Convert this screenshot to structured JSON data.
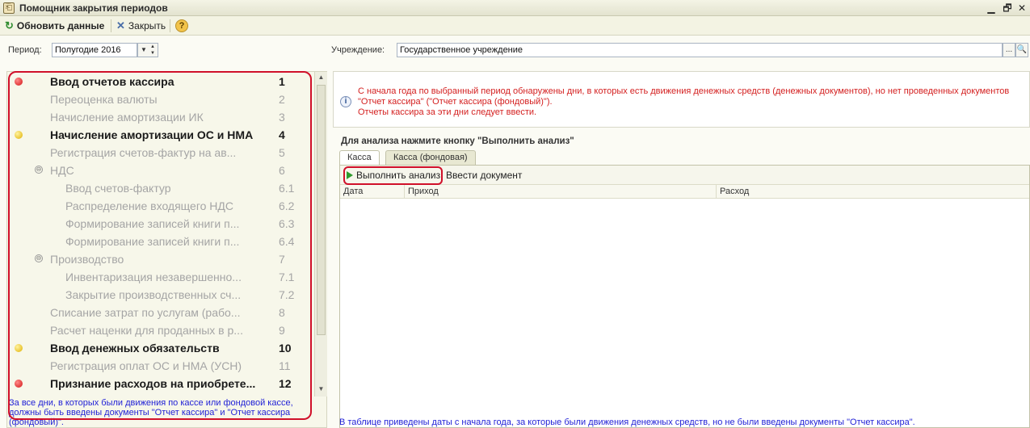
{
  "window": {
    "title": "Помощник закрытия периодов",
    "controls": [
      "▁",
      "🗗",
      "✕"
    ]
  },
  "toolbar": {
    "refresh_label": "Обновить данные",
    "close_label": "Закрыть",
    "help_label": "?"
  },
  "filters": {
    "period_label": "Период:",
    "period_value": "Полугодие 2016",
    "institution_label": "Учреждение:",
    "institution_value": "Государственное учреждение",
    "select_button": "...",
    "search_button": "🔍"
  },
  "tree": {
    "items": [
      {
        "label": "Ввод отчетов кассира",
        "num": "1",
        "status": "red",
        "state": "active"
      },
      {
        "label": "Переоценка валюты",
        "num": "2",
        "status": "",
        "state": "inactive"
      },
      {
        "label": "Начисление амортизации ИК",
        "num": "3",
        "status": "",
        "state": "inactive"
      },
      {
        "label": "Начисление амортизации ОС и НМА",
        "num": "4",
        "status": "yellow",
        "state": "active"
      },
      {
        "label": "Регистрация счетов-фактур на ав...",
        "num": "5",
        "status": "",
        "state": "inactive"
      },
      {
        "label": "НДС",
        "num": "6",
        "status": "",
        "state": "inactive"
      },
      {
        "label": "Ввод счетов-фактур",
        "num": "6.1",
        "status": "",
        "state": "inactive"
      },
      {
        "label": "Распределение входящего НДС",
        "num": "6.2",
        "status": "",
        "state": "inactive"
      },
      {
        "label": "Формирование записей книги п...",
        "num": "6.3",
        "status": "",
        "state": "inactive"
      },
      {
        "label": "Формирование записей книги п...",
        "num": "6.4",
        "status": "",
        "state": "inactive"
      },
      {
        "label": "Производство",
        "num": "7",
        "status": "",
        "state": "inactive"
      },
      {
        "label": "Инвентаризация незавершенно...",
        "num": "7.1",
        "status": "",
        "state": "inactive"
      },
      {
        "label": "Закрытие производственных сч...",
        "num": "7.2",
        "status": "",
        "state": "inactive"
      },
      {
        "label": "Списание затрат по услугам (рабо...",
        "num": "8",
        "status": "",
        "state": "inactive"
      },
      {
        "label": "Расчет наценки для проданных в р...",
        "num": "9",
        "status": "",
        "state": "inactive"
      },
      {
        "label": "Ввод денежных обязательств",
        "num": "10",
        "status": "yellow",
        "state": "active"
      },
      {
        "label": "Регистрация оплат ОС и НМА (УСН)",
        "num": "11",
        "status": "",
        "state": "inactive"
      },
      {
        "label": "Признание расходов на приобрете...",
        "num": "12",
        "status": "red",
        "state": "active"
      }
    ],
    "collapse_glyph": "⊖",
    "note": "За все дни, в которых были движения по кассе или фондовой кассе, должны быть введены документы \"Отчет кассира\" и \"Отчет кассира (фондовый)\"."
  },
  "info": {
    "text_line1": "С начала года по выбранный период обнаружены дни, в которых есть движения денежных средств (денежных документов), но нет проведенных документов",
    "text_line2": "\"Отчет кассира\" (\"Отчет кассира (фондовый)\").",
    "text_line3": "Отчеты кассира за эти дни следует ввести."
  },
  "analysis": {
    "caption": "Для анализа нажмите кнопку \"Выполнить анализ\"",
    "tabs": [
      "Касса",
      "Касса (фондовая)"
    ],
    "run_label": "Выполнить анализ",
    "enter_doc_label": "Ввести документ",
    "columns": [
      "Дата",
      "Приход",
      "Расход"
    ],
    "bottom_note": "В таблице приведены даты с начала года, за которые были движения денежных средств, но не были введены документы \"Отчет кассира\"."
  },
  "colors": {
    "accent_red": "#d0102a",
    "note_blue": "#1f1fd6",
    "info_red": "#d42020"
  }
}
